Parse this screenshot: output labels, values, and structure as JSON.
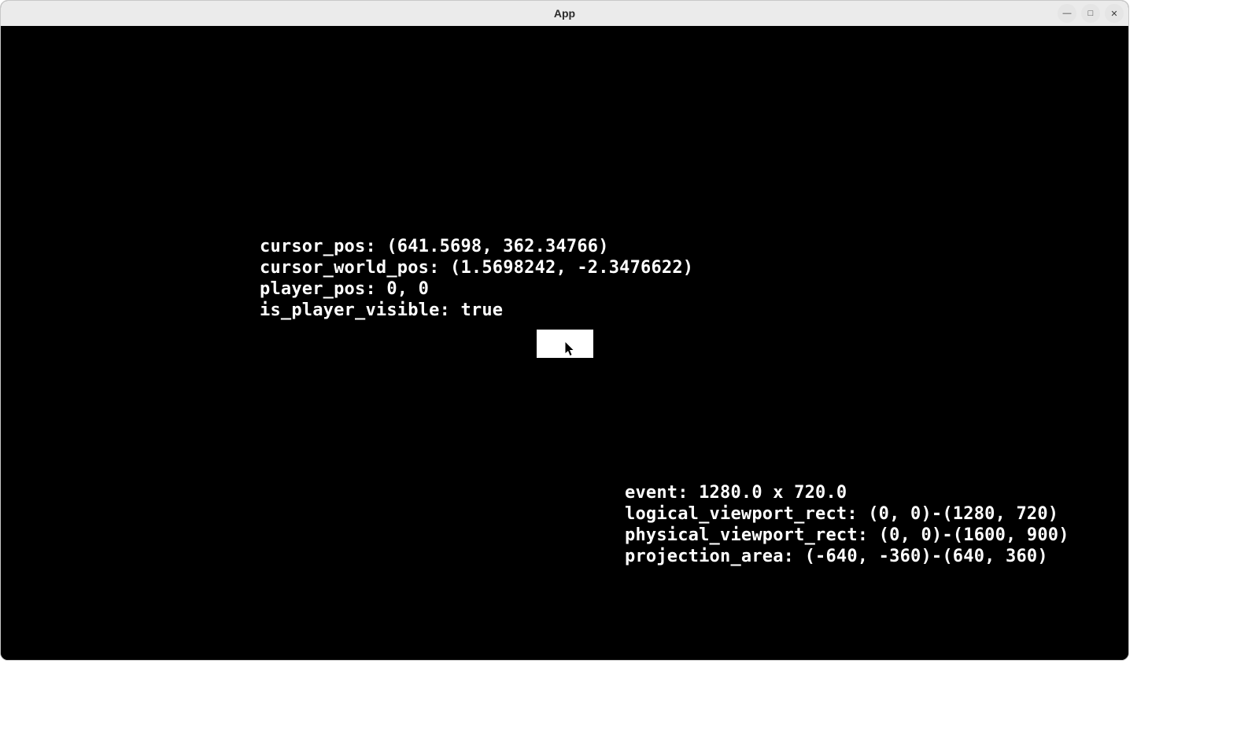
{
  "window": {
    "title": "App"
  },
  "debug_top": {
    "cursor_pos_line": "cursor_pos: (641.5698, 362.34766)",
    "cursor_world_pos_line": "cursor_world_pos: (1.5698242, -2.3476622)",
    "player_pos_line": "player_pos: 0, 0",
    "is_player_visible_line": "is_player_visible: true"
  },
  "debug_bottom": {
    "event_line": "event: 1280.0 x 720.0",
    "logical_viewport_line": "logical_viewport_rect: (0, 0)-(1280, 720)",
    "physical_viewport_line": "physical_viewport_rect: (0, 0)-(1600, 900)",
    "projection_area_line": "projection_area: (-640, -360)-(640, 360)"
  },
  "controls": {
    "minimize_glyph": "―",
    "maximize_glyph": "□",
    "close_glyph": "✕"
  }
}
